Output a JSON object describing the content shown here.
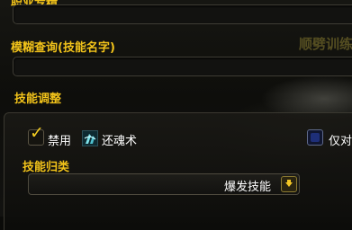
{
  "header": {
    "clipped_title": "职业专精"
  },
  "search": {
    "title": "模糊查询(技能名字)",
    "value": ""
  },
  "watermark": "顺劈训练",
  "skill_adjust": {
    "title": "技能调整",
    "disable_label": "禁用",
    "disable_checked": true,
    "skill_name": "还魂术",
    "skill_icon": "rune-swirl-icon",
    "only_label": "仅对",
    "only_checked": false
  },
  "category": {
    "title": "技能归类",
    "selected": "爆发技能"
  },
  "colors": {
    "accent_gold": "#f2c31a",
    "text_white": "#ffffff"
  }
}
